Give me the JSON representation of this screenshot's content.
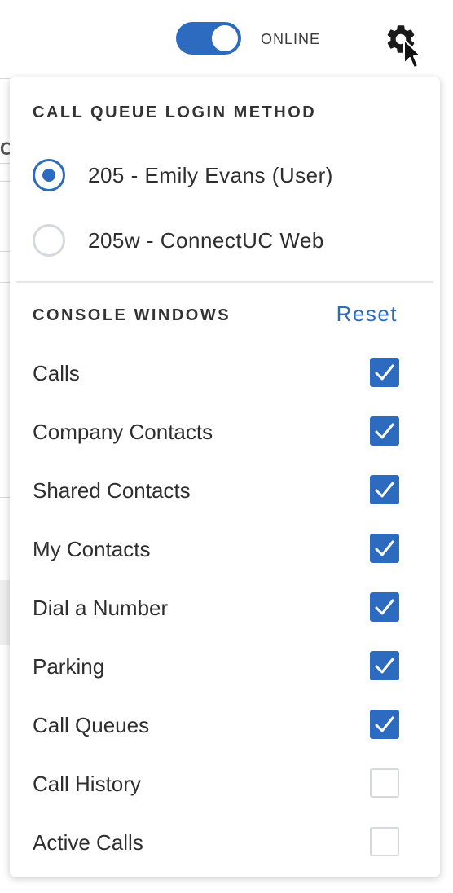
{
  "header": {
    "status_label": "ONLINE",
    "status_on": true
  },
  "background": {
    "partial_letter": "C"
  },
  "panel": {
    "login_method": {
      "heading": "CALL QUEUE LOGIN METHOD",
      "options": [
        {
          "label": "205 - Emily Evans (User)",
          "selected": true
        },
        {
          "label": "205w - ConnectUC Web",
          "selected": false
        }
      ]
    },
    "console_windows": {
      "heading": "CONSOLE WINDOWS",
      "reset_label": "Reset",
      "items": [
        {
          "label": "Calls",
          "checked": true
        },
        {
          "label": "Company Contacts",
          "checked": true
        },
        {
          "label": "Shared Contacts",
          "checked": true
        },
        {
          "label": "My Contacts",
          "checked": true
        },
        {
          "label": "Dial a Number",
          "checked": true
        },
        {
          "label": "Parking",
          "checked": true
        },
        {
          "label": "Call Queues",
          "checked": true
        },
        {
          "label": "Call History",
          "checked": false
        },
        {
          "label": "Active Calls",
          "checked": false
        }
      ]
    }
  },
  "colors": {
    "accent": "#2d6bc0",
    "text": "#2e2e2e",
    "border": "#d5d9de"
  },
  "icons": {
    "settings": "gear-icon",
    "pointer": "mouse-cursor-icon",
    "check": "checkmark-icon"
  }
}
